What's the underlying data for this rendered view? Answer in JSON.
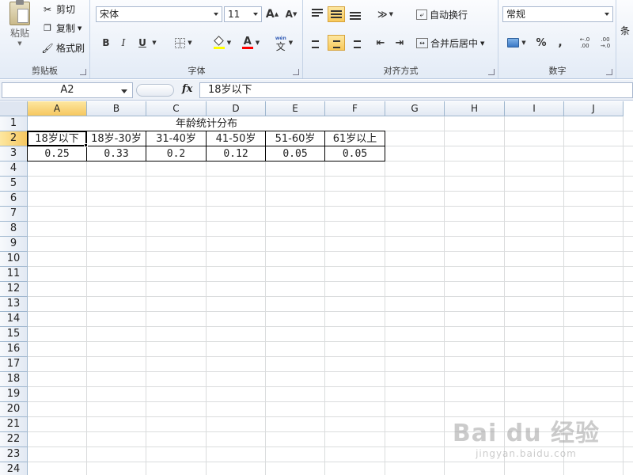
{
  "ribbon": {
    "clipboard": {
      "paste_label": "粘贴",
      "cut_label": "剪切",
      "copy_label": "复制",
      "format_painter_label": "格式刷",
      "group_label": "剪贴板"
    },
    "font": {
      "font_name": "宋体",
      "font_size": "11",
      "bold": "B",
      "italic": "I",
      "underline": "U",
      "grow_font": "A",
      "shrink_font": "A",
      "font_color_glyph": "A",
      "phonetic_glyph": "文",
      "group_label": "字体"
    },
    "alignment": {
      "wrap_text_label": "自动换行",
      "merge_center_label": "合并后居中",
      "group_label": "对齐方式"
    },
    "number": {
      "format_value": "常规",
      "percent": "%",
      "comma": ",",
      "inc_decimal": "←.0 .00",
      "dec_decimal": ".00 →.0",
      "group_label": "数字"
    },
    "styles": {
      "conditional_label": "条"
    }
  },
  "formula_bar": {
    "name_box": "A2",
    "fx_label": "fx",
    "formula": "18岁以下"
  },
  "sheet": {
    "columns": [
      "A",
      "B",
      "C",
      "D",
      "E",
      "F",
      "G",
      "H",
      "I",
      "J"
    ],
    "rows": [
      "1",
      "2",
      "3",
      "4",
      "5",
      "6",
      "7",
      "8",
      "9",
      "10",
      "11",
      "12",
      "13",
      "14",
      "15",
      "16",
      "17",
      "18",
      "19",
      "20",
      "21",
      "22",
      "23",
      "24"
    ],
    "selected_column": "A",
    "selected_row": "2",
    "title": "年龄统计分布",
    "headers": [
      "18岁以下",
      "18岁-30岁",
      "31-40岁",
      "41-50岁",
      "51-60岁",
      "61岁以上"
    ],
    "values": [
      "0.25",
      "0.33",
      "0.2",
      "0.12",
      "0.05",
      "0.05"
    ]
  },
  "watermark": {
    "line1": "Bai du 经验",
    "line2": "jingyan.baidu.com"
  }
}
